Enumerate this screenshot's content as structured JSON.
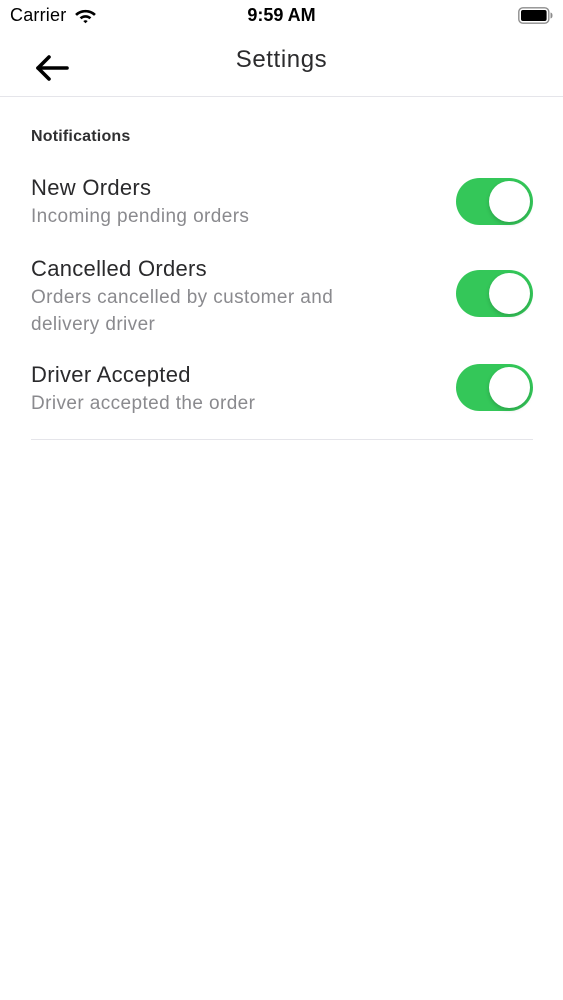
{
  "status_bar": {
    "carrier": "Carrier",
    "time": "9:59 AM",
    "wifi_icon": "wifi-icon",
    "battery_icon": "battery-icon"
  },
  "nav": {
    "title": "Settings",
    "back_icon": "arrow-left-icon"
  },
  "notifications": {
    "header": "Notifications",
    "items": [
      {
        "title": "New Orders",
        "subtitle": "Incoming pending orders",
        "enabled": true
      },
      {
        "title": "Cancelled Orders",
        "subtitle": "Orders cancelled by customer and delivery driver",
        "enabled": true
      },
      {
        "title": "Driver Accepted",
        "subtitle": "Driver accepted the order",
        "enabled": true
      }
    ]
  },
  "colors": {
    "toggle_on": "#34c759",
    "divider": "#e5e5ea",
    "subtitle": "#8a8a8e"
  }
}
